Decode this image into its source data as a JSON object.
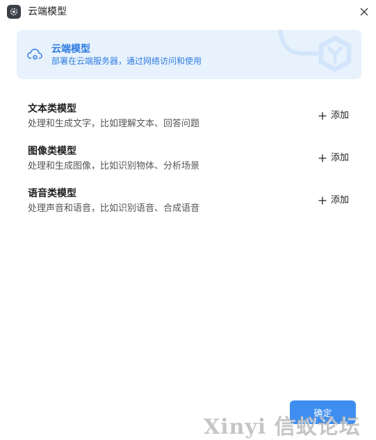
{
  "window": {
    "title": "云端模型",
    "icons": {
      "app": "gear-icon",
      "close": "close-icon"
    }
  },
  "banner": {
    "title": "云端模型",
    "subtitle": "部署在云端服务器，通过网络访问和使用",
    "icon": "cloud-settings-icon",
    "accent_color": "#2f7de1",
    "background_color": "#e8f2fd"
  },
  "model_types": [
    {
      "title": "文本类模型",
      "description": "处理和生成文字，比如理解文本、回答问题",
      "add_label": "添加"
    },
    {
      "title": "图像类模型",
      "description": "处理和生成图像，比如识别物体、分析场景",
      "add_label": "添加"
    },
    {
      "title": "语音类模型",
      "description": "处理声音和语音，比如识别语音、合成语音",
      "add_label": "添加"
    }
  ],
  "footer": {
    "confirm_label": "确定",
    "confirm_color": "#3d8ef0"
  },
  "watermark": "Xinyi 信蚁论坛"
}
